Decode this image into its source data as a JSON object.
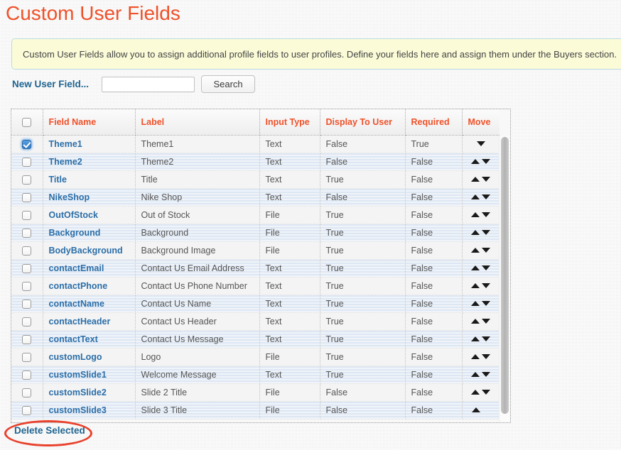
{
  "page": {
    "title": "Custom User Fields"
  },
  "info_banner": {
    "text": "Custom User Fields allow you to assign additional profile fields to user profiles. Define your fields here and assign them under the Buyers section.",
    "background_color": "#fbfbd8",
    "border_color": "#bcdde3"
  },
  "toolbar": {
    "new_user_field_label": "New User Field...",
    "search_value": "",
    "search_placeholder": "",
    "search_button_label": "Search"
  },
  "table": {
    "columns": [
      {
        "key": "select",
        "label": ""
      },
      {
        "key": "field_name",
        "label": "Field Name"
      },
      {
        "key": "label",
        "label": "Label"
      },
      {
        "key": "input_type",
        "label": "Input Type"
      },
      {
        "key": "display_to_user",
        "label": "Display To User"
      },
      {
        "key": "required",
        "label": "Required"
      },
      {
        "key": "move",
        "label": "Move"
      }
    ],
    "header_checkbox_checked": false,
    "rows": [
      {
        "checked": true,
        "field_name": "Theme1",
        "label": "Theme1",
        "input_type": "Text",
        "display_to_user": "False",
        "required": "True",
        "move": "down"
      },
      {
        "checked": false,
        "field_name": "Theme2",
        "label": "Theme2",
        "input_type": "Text",
        "display_to_user": "False",
        "required": "False",
        "move": "both"
      },
      {
        "checked": false,
        "field_name": "Title",
        "label": "Title",
        "input_type": "Text",
        "display_to_user": "True",
        "required": "False",
        "move": "both"
      },
      {
        "checked": false,
        "field_name": "NikeShop",
        "label": "Nike Shop",
        "input_type": "Text",
        "display_to_user": "False",
        "required": "False",
        "move": "both"
      },
      {
        "checked": false,
        "field_name": "OutOfStock",
        "label": "Out of Stock",
        "input_type": "File",
        "display_to_user": "True",
        "required": "False",
        "move": "both"
      },
      {
        "checked": false,
        "field_name": "Background",
        "label": "Background",
        "input_type": "File",
        "display_to_user": "True",
        "required": "False",
        "move": "both"
      },
      {
        "checked": false,
        "field_name": "BodyBackground",
        "label": "Background Image",
        "input_type": "File",
        "display_to_user": "True",
        "required": "False",
        "move": "both"
      },
      {
        "checked": false,
        "field_name": "contactEmail",
        "label": "Contact Us Email Address",
        "input_type": "Text",
        "display_to_user": "True",
        "required": "False",
        "move": "both"
      },
      {
        "checked": false,
        "field_name": "contactPhone",
        "label": "Contact Us Phone Number",
        "input_type": "Text",
        "display_to_user": "True",
        "required": "False",
        "move": "both"
      },
      {
        "checked": false,
        "field_name": "contactName",
        "label": "Contact Us Name",
        "input_type": "Text",
        "display_to_user": "True",
        "required": "False",
        "move": "both"
      },
      {
        "checked": false,
        "field_name": "contactHeader",
        "label": "Contact Us Header",
        "input_type": "Text",
        "display_to_user": "True",
        "required": "False",
        "move": "both"
      },
      {
        "checked": false,
        "field_name": "contactText",
        "label": "Contact Us Message",
        "input_type": "Text",
        "display_to_user": "True",
        "required": "False",
        "move": "both"
      },
      {
        "checked": false,
        "field_name": "customLogo",
        "label": "Logo",
        "input_type": "File",
        "display_to_user": "True",
        "required": "False",
        "move": "both"
      },
      {
        "checked": false,
        "field_name": "customSlide1",
        "label": "Welcome Message",
        "input_type": "Text",
        "display_to_user": "True",
        "required": "False",
        "move": "both"
      },
      {
        "checked": false,
        "field_name": "customSlide2",
        "label": "Slide 2 Title",
        "input_type": "File",
        "display_to_user": "False",
        "required": "False",
        "move": "both"
      },
      {
        "checked": false,
        "field_name": "customSlide3",
        "label": "Slide 3 Title",
        "input_type": "File",
        "display_to_user": "False",
        "required": "False",
        "move": "up"
      }
    ]
  },
  "footer": {
    "delete_selected_label": "Delete Selected"
  },
  "annotation": {
    "shape": "ellipse",
    "color": "#e8412c",
    "target": "Delete Selected"
  },
  "colors": {
    "accent_orange": "#ef512a",
    "link_blue": "#1f6490",
    "row_stripe_blue": "#dde7f3",
    "page_background": "#f4f4f4"
  }
}
